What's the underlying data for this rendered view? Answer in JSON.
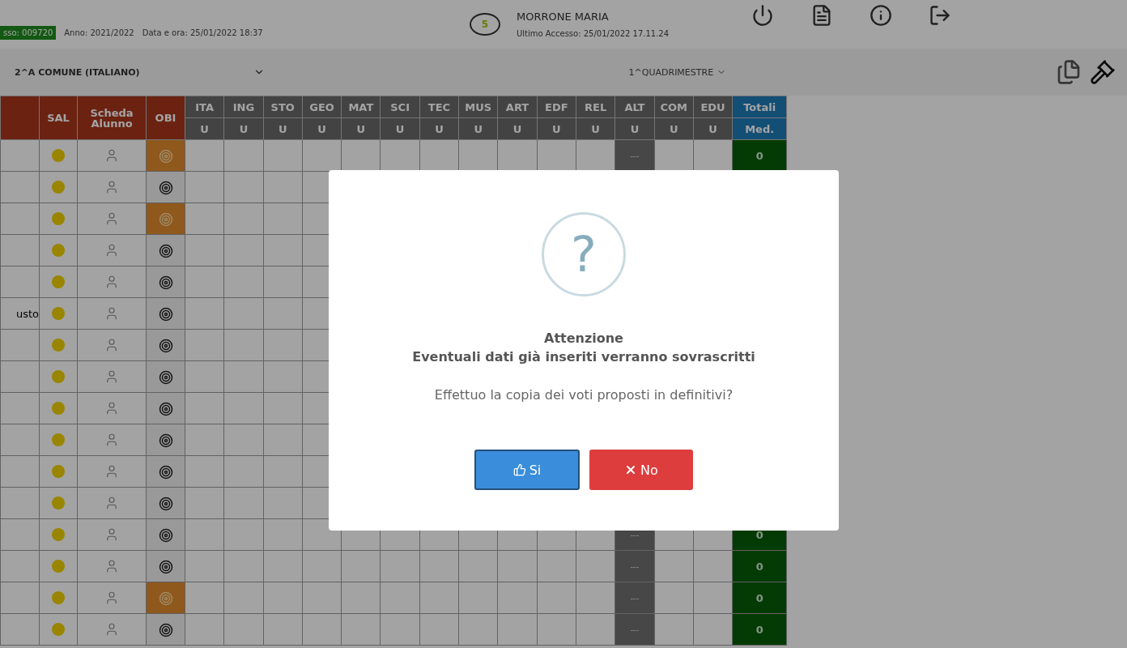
{
  "header": {
    "class_badge": "sso: 009720",
    "year": "Anno: 2021/2022",
    "datetime": "Data e ora: 25/01/2022 18:37",
    "notification_count": "5",
    "user_name": "MORRONE MARIA",
    "last_access": "Ultimo Accesso: 25/01/2022 17.11.24"
  },
  "toolbar": {
    "class_select": "2^A COMUNE (ITALIANO)",
    "period_select": "1^QUADRIMESTRE"
  },
  "table": {
    "fixed_columns": [
      "SAL",
      "Scheda Alunno",
      "OBI"
    ],
    "subjects": [
      {
        "code": "ITA",
        "sub": "U"
      },
      {
        "code": "ING",
        "sub": "U"
      },
      {
        "code": "STO",
        "sub": "U"
      },
      {
        "code": "GEO",
        "sub": "U"
      },
      {
        "code": "MAT",
        "sub": "U"
      },
      {
        "code": "SCI",
        "sub": "U"
      },
      {
        "code": "TEC",
        "sub": "U"
      },
      {
        "code": "MUS",
        "sub": "U"
      },
      {
        "code": "ART",
        "sub": "U"
      },
      {
        "code": "EDF",
        "sub": "U"
      },
      {
        "code": "REL",
        "sub": "U"
      },
      {
        "code": "ALT",
        "sub": "U"
      },
      {
        "code": "COM",
        "sub": "U"
      },
      {
        "code": "EDU",
        "sub": "U"
      }
    ],
    "totals": {
      "label": "Totali",
      "sub": "Med."
    },
    "rows": [
      {
        "obi_flagged": true,
        "alt": "---",
        "total": "0"
      },
      {
        "obi_flagged": false
      },
      {
        "obi_flagged": true
      },
      {
        "obi_flagged": false
      },
      {
        "obi_flagged": false
      },
      {
        "name": "usto",
        "obi_flagged": false
      },
      {
        "obi_flagged": false
      },
      {
        "obi_flagged": false
      },
      {
        "obi_flagged": false
      },
      {
        "obi_flagged": false
      },
      {
        "obi_flagged": false
      },
      {
        "obi_flagged": false
      },
      {
        "obi_flagged": false,
        "alt": "---",
        "total": "0"
      },
      {
        "obi_flagged": false,
        "alt": "---",
        "total": "0"
      },
      {
        "obi_flagged": true,
        "alt": "---",
        "total": "0"
      },
      {
        "obi_flagged": false,
        "alt": "---",
        "total": "0"
      }
    ]
  },
  "dialog": {
    "icon": "?",
    "title": "Attenzione",
    "warning": "Eventuali dati già inseriti verranno sovrascritti",
    "question": "Effettuo la copia dei voti proposti in definitivi?",
    "buttons": [
      {
        "kind": "confirm",
        "label": "Si"
      },
      {
        "kind": "cancel",
        "label": "No"
      }
    ]
  }
}
